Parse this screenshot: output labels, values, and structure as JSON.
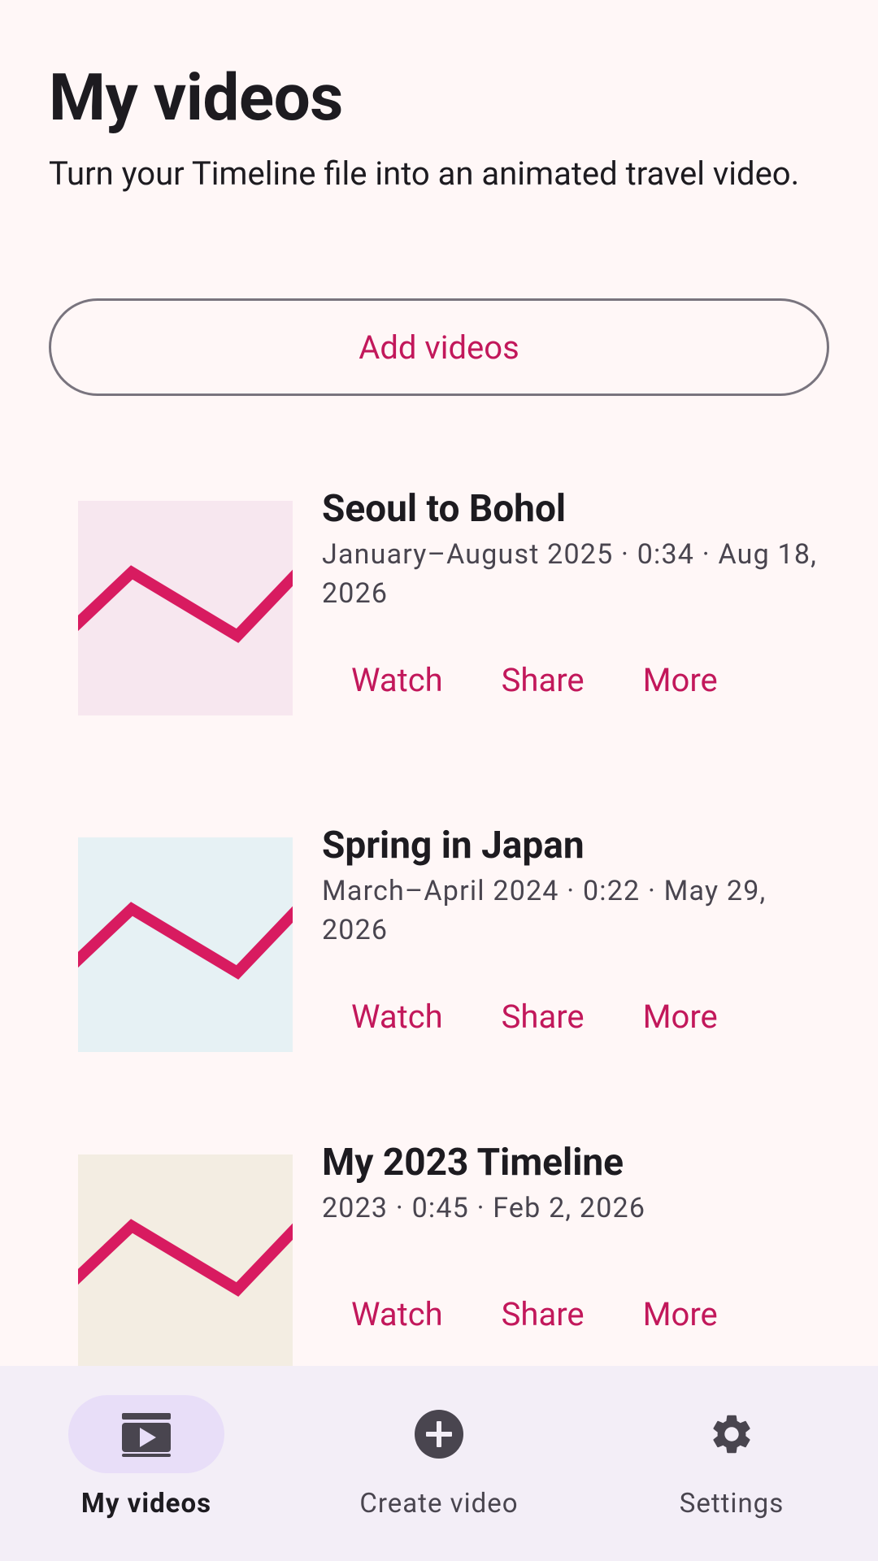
{
  "header": {
    "title": "My videos",
    "subtitle": "Turn your Timeline file into an animated travel video."
  },
  "add_button": {
    "label": "Add videos"
  },
  "videos": [
    {
      "title": "Seoul to Bohol",
      "meta": "January–August 2025 · 0:34 · Aug 18, 2026",
      "thumb_bg": "#f7e7ef",
      "actions": {
        "watch": "Watch",
        "share": "Share",
        "more": "More"
      }
    },
    {
      "title": "Spring in Japan",
      "meta": "March–April 2024 · 0:22 · May 29, 2026",
      "thumb_bg": "#e6f1f4",
      "actions": {
        "watch": "Watch",
        "share": "Share",
        "more": "More"
      }
    },
    {
      "title": "My 2023 Timeline",
      "meta": "2023 · 0:45 · Feb 2, 2026",
      "thumb_bg": "#f3ede2",
      "actions": {
        "watch": "Watch",
        "share": "Share",
        "more": "More"
      }
    }
  ],
  "bottom_nav": {
    "items": [
      {
        "label": "My videos",
        "icon": "video-library-icon",
        "active": true
      },
      {
        "label": "Create video",
        "icon": "add-circle-icon",
        "active": false
      },
      {
        "label": "Settings",
        "icon": "gear-icon",
        "active": false
      }
    ]
  },
  "colors": {
    "accent": "#c2185b",
    "background": "#fff7f7",
    "nav_background": "#f3eef7",
    "nav_active_pill": "#e8def8",
    "route_line": "#d81b60"
  }
}
